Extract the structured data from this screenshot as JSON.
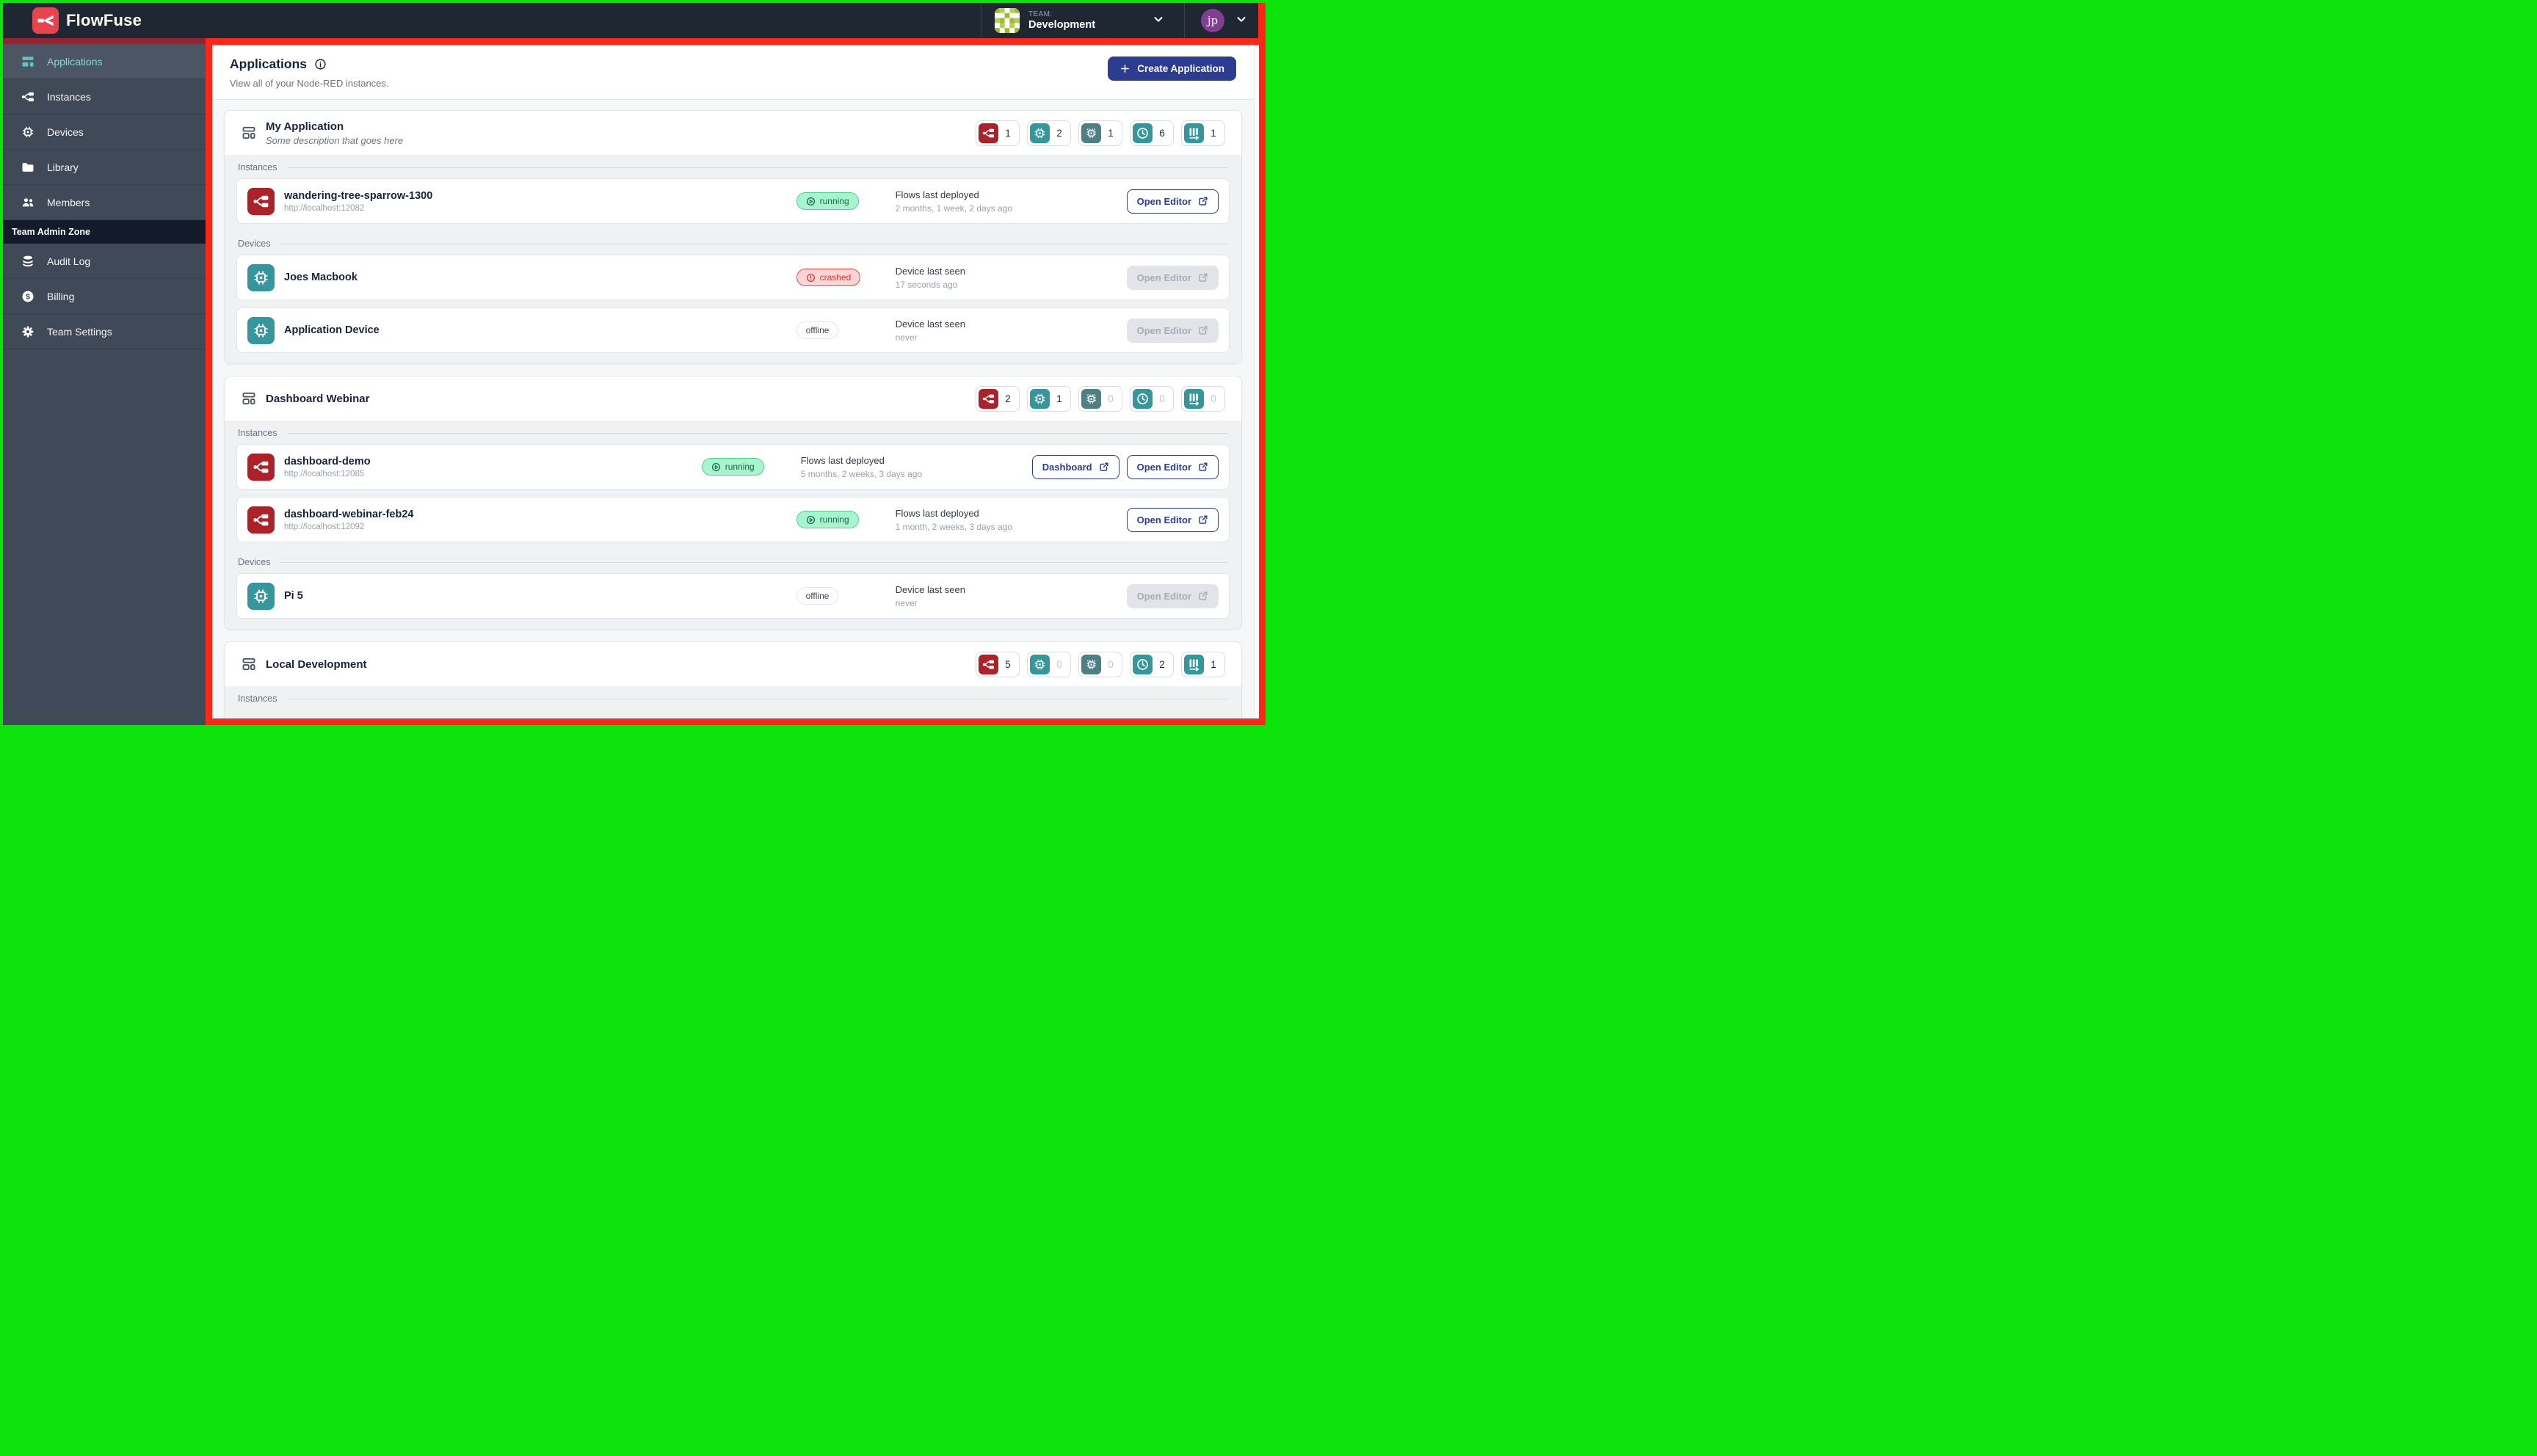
{
  "navbar": {
    "brand": "FlowFuse",
    "team_label": "TEAM:",
    "team_name": "Development",
    "user_initials": "jp"
  },
  "sidebar": {
    "items": [
      {
        "label": "Applications",
        "active": true
      },
      {
        "label": "Instances",
        "active": false
      },
      {
        "label": "Devices",
        "active": false
      },
      {
        "label": "Library",
        "active": false
      },
      {
        "label": "Members",
        "active": false
      }
    ],
    "admin_zone_label": "Team Admin Zone",
    "admin_items": [
      {
        "label": "Audit Log"
      },
      {
        "label": "Billing"
      },
      {
        "label": "Team Settings"
      }
    ]
  },
  "header": {
    "title": "Applications",
    "subtitle": "View all of your Node-RED instances.",
    "create_button": "Create Application"
  },
  "labels": {
    "instances": "Instances",
    "devices": "Devices",
    "flows_last_deployed": "Flows last deployed",
    "device_last_seen": "Device last seen"
  },
  "buttons": {
    "open_editor": "Open Editor",
    "dashboard": "Dashboard"
  },
  "cards": [
    {
      "title": "My Application",
      "description": "Some description that goes here",
      "badges": [
        "1",
        "2",
        "1",
        "6",
        "1"
      ],
      "instances": [
        {
          "name": "wandering-tree-sparrow-1300",
          "url": "http://localhost:12082",
          "status": "running",
          "meta_value": "2 months, 1 week, 2 days ago"
        }
      ],
      "devices": [
        {
          "name": "Joes Macbook",
          "status": "crashed",
          "meta_value": "17 seconds ago"
        },
        {
          "name": "Application Device",
          "status": "offline",
          "meta_value": "never"
        }
      ]
    },
    {
      "title": "Dashboard Webinar",
      "badges": [
        "2",
        "1",
        "0",
        "0",
        "0"
      ],
      "instances": [
        {
          "name": "dashboard-demo",
          "url": "http://localhost:12085",
          "status": "running",
          "meta_value": "5 months, 2 weeks, 3 days ago"
        },
        {
          "name": "dashboard-webinar-feb24",
          "url": "http://localhost:12092",
          "status": "running",
          "meta_value": "1 month, 2 weeks, 3 days ago"
        }
      ],
      "devices": [
        {
          "name": "Pi 5",
          "status": "offline",
          "meta_value": "never"
        }
      ]
    },
    {
      "title": "Local Development",
      "badges": [
        "5",
        "0",
        "0",
        "2",
        "1"
      ]
    }
  ],
  "colors": {
    "frame_green": "#0be30b",
    "highlight_red": "#FF2617",
    "sidebar_underline_red": "#99222E",
    "brand_red": "#E9434C",
    "node_red": "#AD2128",
    "teal": "#35969B",
    "indigo_button": "#2C3C90",
    "running_green": "#A9F4CE",
    "crashed_red": "#FBD5D5"
  }
}
